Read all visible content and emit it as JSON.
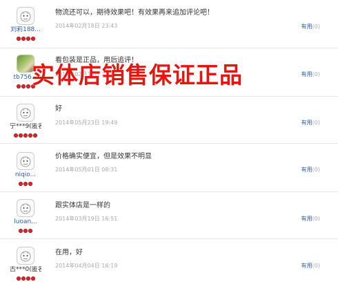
{
  "reviews": [
    {
      "username": "刘莉188...",
      "comment": "物流还可以，期待效果吧！有效果再来追加评论吧！",
      "date": "2014年02月18日 23:43",
      "useful_label": "有用",
      "useful_count": "(0)",
      "avatar": "default-avatar"
    },
    {
      "username": "tb756...",
      "comment": "看包装是正品，用后追评！",
      "date": "2014年02月18日 23:43",
      "useful_label": "有用",
      "useful_count": "(0)",
      "avatar": "photo-avatar"
    },
    {
      "username": "宁***9(匿名)",
      "comment": "好",
      "date": "2014年05月23日 19:49",
      "useful_label": "有用",
      "useful_count": "(0)",
      "avatar": "default-avatar"
    },
    {
      "username": "niqio...",
      "comment": "价格确实便宜，但是效果不明显",
      "date": "2014年05月01日 08:31",
      "useful_label": "有用",
      "useful_count": "(0)",
      "avatar": "default-avatar"
    },
    {
      "username": "luoan...",
      "comment": "跟实体店是一样的",
      "date": "2014年03月19日 16:51",
      "useful_label": "有用",
      "useful_count": "(0)",
      "avatar": "default-avatar"
    },
    {
      "username": "古***0(匿名)",
      "comment": "在用，好",
      "date": "2014年04月04日 16:19",
      "useful_label": "有用",
      "useful_count": "(0)",
      "avatar": "default-avatar"
    }
  ],
  "overlay_text": "实体店销售保证正品",
  "colors": {
    "overlay": "#e5150f",
    "link": "#2b5ea8",
    "date": "#aaaaaa",
    "heart": "#d8262c"
  }
}
